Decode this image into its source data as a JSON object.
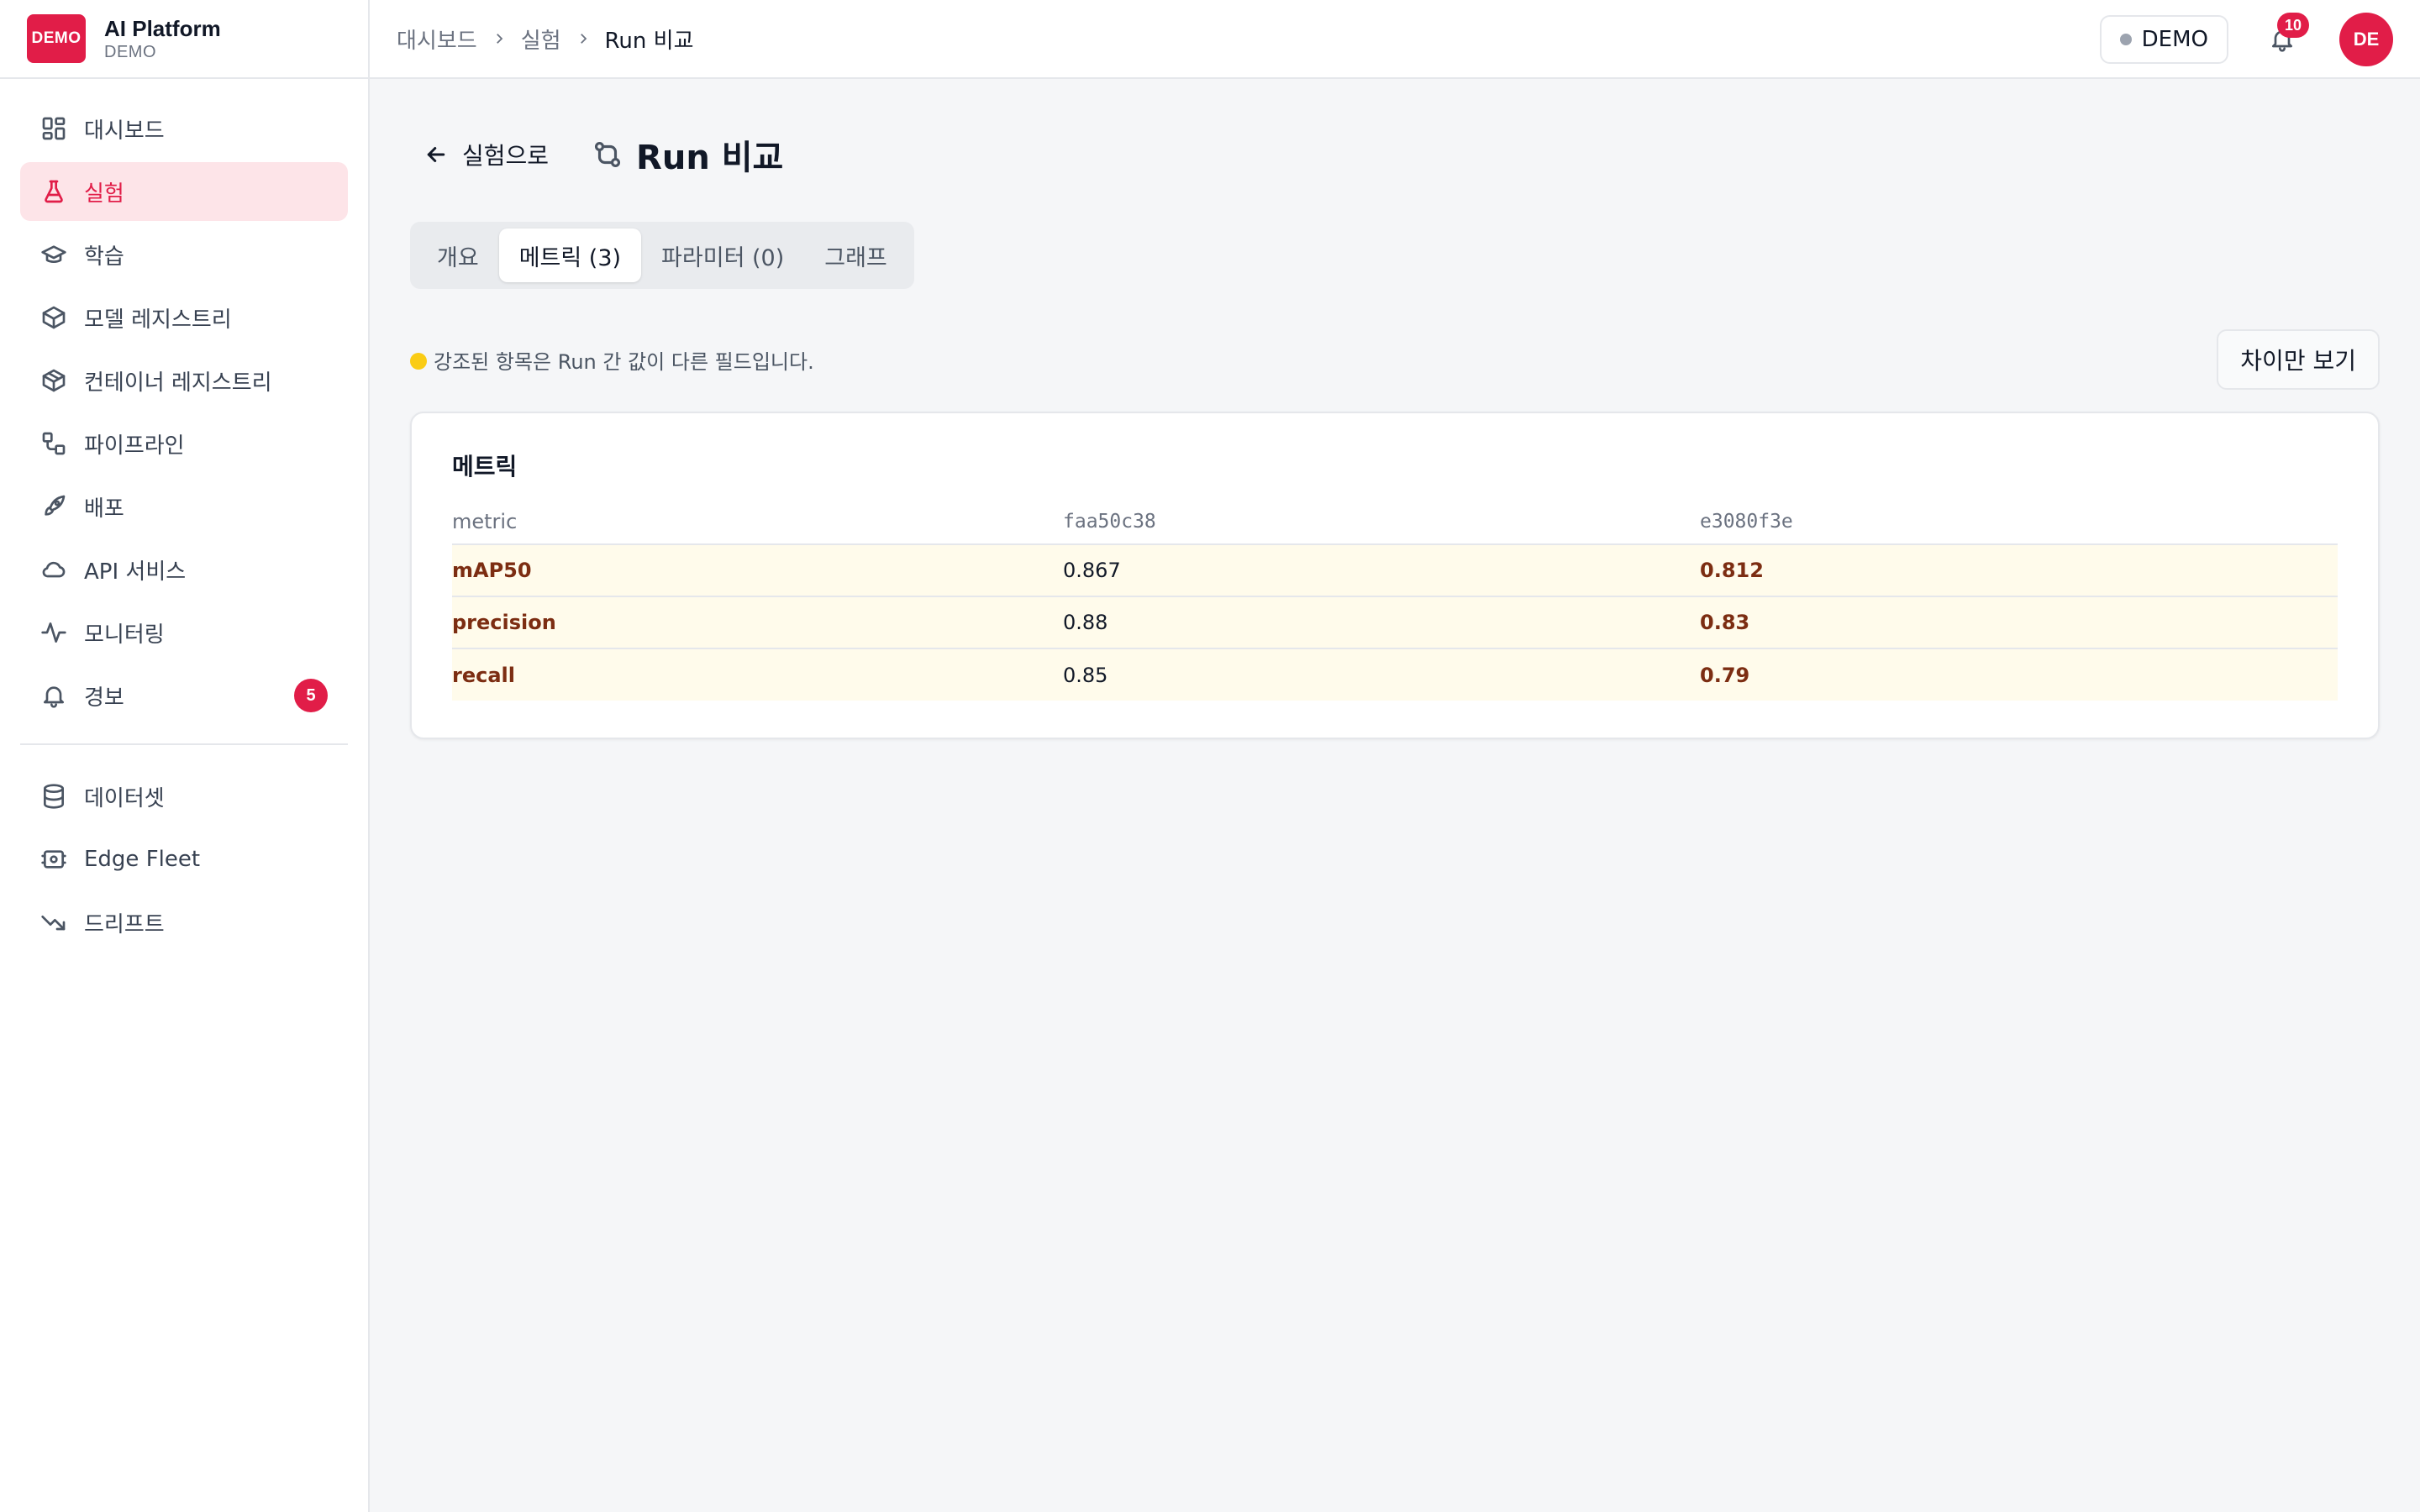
{
  "brand": {
    "logo_text": "DEMO",
    "title": "AI Platform",
    "subtitle": "DEMO"
  },
  "sidebar": {
    "items": [
      {
        "label": "대시보드",
        "icon": "dashboard-icon"
      },
      {
        "label": "실험",
        "icon": "flask-icon",
        "active": true
      },
      {
        "label": "학습",
        "icon": "graduation-cap-icon"
      },
      {
        "label": "모델 레지스트리",
        "icon": "box-icon"
      },
      {
        "label": "컨테이너 레지스트리",
        "icon": "package-icon"
      },
      {
        "label": "파이프라인",
        "icon": "workflow-icon"
      },
      {
        "label": "배포",
        "icon": "rocket-icon"
      },
      {
        "label": "API 서비스",
        "icon": "cloud-icon"
      },
      {
        "label": "모니터링",
        "icon": "activity-icon"
      },
      {
        "label": "경보",
        "icon": "bell-icon",
        "badge": "5"
      }
    ],
    "items2": [
      {
        "label": "데이터셋",
        "icon": "database-icon"
      },
      {
        "label": "Edge Fleet",
        "icon": "edge-device-icon"
      },
      {
        "label": "드리프트",
        "icon": "trending-down-icon"
      }
    ]
  },
  "header": {
    "breadcrumb": [
      "대시보드",
      "실험",
      "Run 비교"
    ],
    "env_label": "DEMO",
    "notification_count": "10",
    "avatar_initials": "DE"
  },
  "page": {
    "back_label": "실험으로",
    "title": "Run 비교",
    "tabs": [
      "개요",
      "메트릭 (3)",
      "파라미터 (0)",
      "그래프"
    ],
    "active_tab": 1,
    "note": "강조된 항목은 Run 간 값이 다른 필드입니다.",
    "diff_button": "차이만 보기"
  },
  "metrics_card": {
    "title": "메트릭",
    "columns": [
      "metric",
      "faa50c38",
      "e3080f3e"
    ],
    "rows": [
      {
        "metric": "mAP50",
        "a": "0.867",
        "b": "0.812"
      },
      {
        "metric": "precision",
        "a": "0.88",
        "b": "0.83"
      },
      {
        "metric": "recall",
        "a": "0.85",
        "b": "0.79"
      }
    ]
  },
  "colors": {
    "accent": "#e11d48",
    "active_bg": "#fde4e8",
    "highlight_row": "#fffbeb",
    "highlight_text": "#7c2d12",
    "note_dot": "#facc15"
  }
}
